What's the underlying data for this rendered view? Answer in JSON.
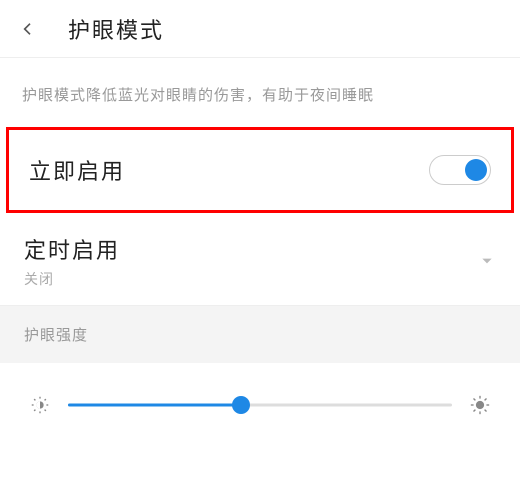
{
  "header": {
    "title": "护眼模式"
  },
  "description": "护眼模式降低蓝光对眼睛的伤害，有助于夜间睡眠",
  "enable_now": {
    "label": "立即启用",
    "on": true
  },
  "schedule": {
    "label": "定时启用",
    "status": "关闭"
  },
  "intensity": {
    "label": "护眼强度",
    "value_percent": 45
  },
  "colors": {
    "accent": "#1e88e5",
    "highlight_border": "#ff0000"
  }
}
